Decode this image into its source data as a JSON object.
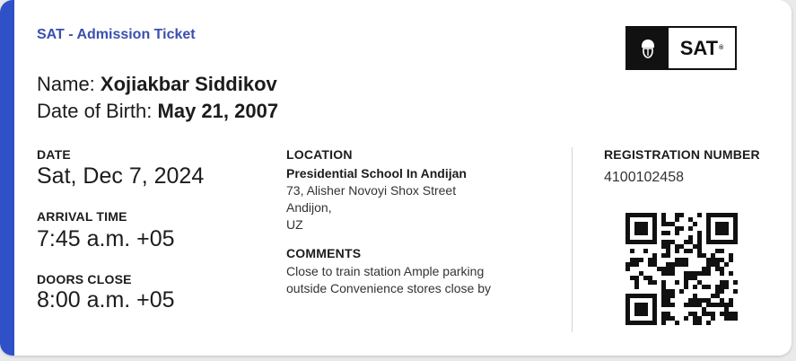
{
  "header": {
    "title": "SAT - Admission Ticket",
    "logo_text": "SAT",
    "logo_mark": "®"
  },
  "candidate": {
    "name_label": "Name:",
    "name_value": "Xojiakbar Siddikov",
    "dob_label": "Date of Birth:",
    "dob_value": "May 21, 2007"
  },
  "schedule": {
    "date_label": "DATE",
    "date_value": "Sat, Dec 7, 2024",
    "arrival_label": "ARRIVAL TIME",
    "arrival_value": "7:45 a.m. +05",
    "doors_label": "DOORS CLOSE",
    "doors_value": "8:00 a.m. +05"
  },
  "location": {
    "label": "LOCATION",
    "name": "Presidential School In Andijan",
    "street": "73, Alisher Novoyi Shox Street",
    "city": "Andijon,",
    "country": "UZ"
  },
  "comments": {
    "label": "COMMENTS",
    "line1": "Close to train station Ample parking",
    "line2": "outside Convenience stores close by"
  },
  "registration": {
    "label": "REGISTRATION NUMBER",
    "number": "4100102458"
  },
  "icons": {
    "logo_icon": "acorn-icon",
    "qr": "qr-code"
  },
  "colors": {
    "accent": "#3050c8",
    "title": "#3a4fb0"
  }
}
